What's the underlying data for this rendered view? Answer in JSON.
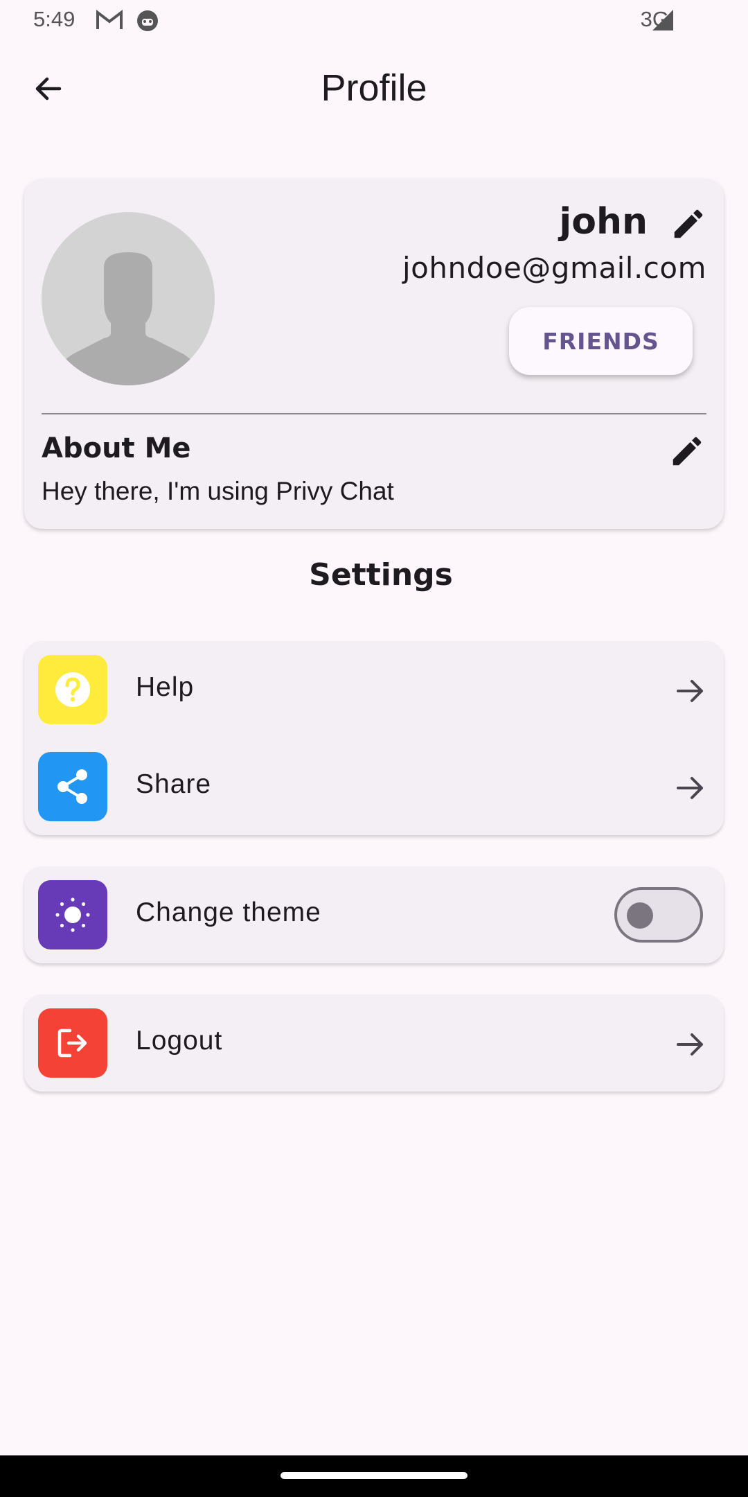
{
  "status_bar": {
    "time": "5:49",
    "network": "3G",
    "icons": [
      "gmail-icon",
      "android-debug-icon",
      "signal-icon"
    ]
  },
  "app_bar": {
    "title": "Profile",
    "back_icon": "arrow-back-icon"
  },
  "profile": {
    "name": "john",
    "email": "johndoe@gmail.com",
    "friends_label": "FRIENDS",
    "about_title": "About Me",
    "about_text": "Hey there, I'm using Privy Chat"
  },
  "settings": {
    "title": "Settings",
    "items": [
      {
        "label": "Help",
        "icon": "help-icon",
        "color": "#ffeb3b",
        "action": "arrow"
      },
      {
        "label": "Share",
        "icon": "share-icon",
        "color": "#2196f3",
        "action": "arrow"
      },
      {
        "label": "Change theme",
        "icon": "sun-icon",
        "color": "#673ab7",
        "action": "toggle",
        "toggle_on": false
      },
      {
        "label": "Logout",
        "icon": "logout-icon",
        "color": "#f44336",
        "action": "arrow"
      }
    ]
  },
  "colors": {
    "background": "#fdf7fb",
    "card": "#f4eff4",
    "accent": "#65558f"
  }
}
